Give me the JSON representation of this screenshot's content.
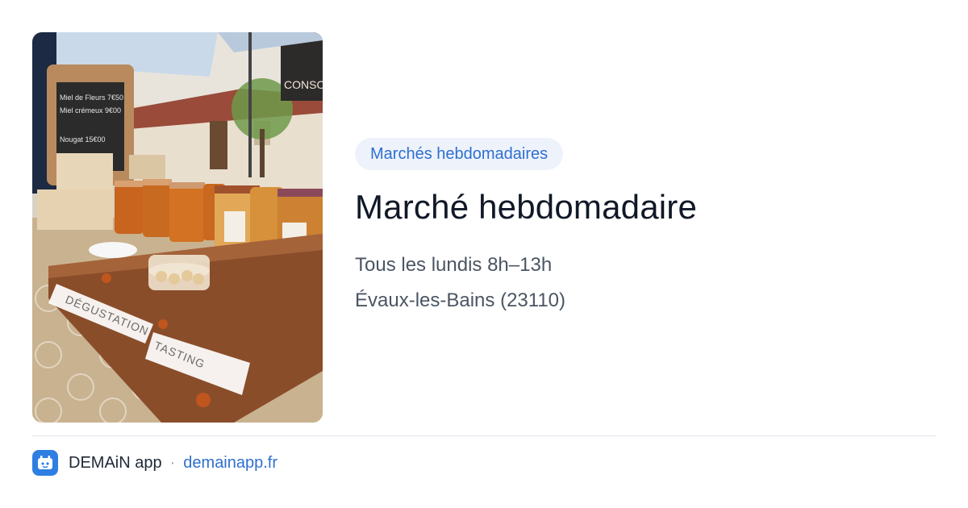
{
  "event": {
    "category_badge": "Marchés hebdomadaires",
    "title": "Marché hebdomadaire",
    "schedule": "Tous les lundis 8h–13h",
    "location": "Évaux-les-Bains (23110)"
  },
  "photo": {
    "board_lines": [
      "Miel de Fleurs 7€50",
      "Miel crémeux 9€00",
      "Nougat 15€00"
    ],
    "sign_text": "CONSOM",
    "tasting_label_fr": "DÉGUSTATION",
    "tasting_label_en": "TASTING"
  },
  "footer": {
    "app_name": "DEMAiN app",
    "separator": "·",
    "url": "demainapp.fr"
  },
  "colors": {
    "accent": "#2f6fd1",
    "badge_bg": "#eef3fb",
    "app_icon_bg": "#2f7fe3"
  }
}
